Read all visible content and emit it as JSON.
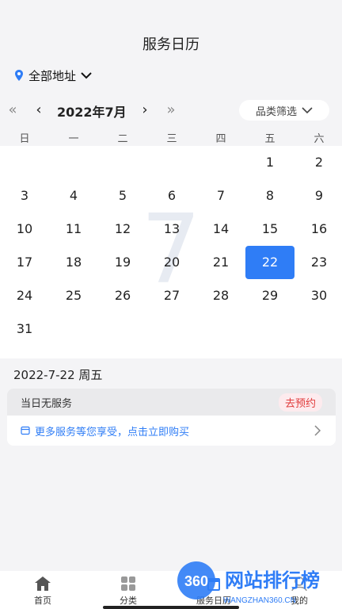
{
  "header": {
    "title": "服务日历"
  },
  "address": {
    "label": "全部地址"
  },
  "calendar_nav": {
    "prev_year": "«",
    "prev_month": "‹",
    "month_label": "2022年7月",
    "next_month": "›",
    "next_year": "»",
    "filter_label": "品类筛选"
  },
  "weekdays": [
    "日",
    "一",
    "二",
    "三",
    "四",
    "五",
    "六"
  ],
  "calendar": {
    "watermark": "7",
    "days": [
      "1",
      "2",
      "3",
      "4",
      "5",
      "6",
      "7",
      "8",
      "9",
      "10",
      "11",
      "12",
      "13",
      "14",
      "15",
      "16",
      "17",
      "18",
      "19",
      "20",
      "21",
      "22",
      "23",
      "24",
      "25",
      "26",
      "27",
      "28",
      "29",
      "30",
      "31"
    ],
    "first_weekday": 5,
    "selected_day": "22"
  },
  "selected": {
    "date_heading": "2022-7-22 周五",
    "no_service": "当日无服务",
    "reserve_label": "去预约",
    "promo_text": "更多服务等您享受，点击立即购买"
  },
  "tabbar": {
    "items": [
      {
        "label": "首页",
        "icon": "home-icon"
      },
      {
        "label": "分类",
        "icon": "category-icon"
      },
      {
        "label": "服务日历",
        "icon": "calendar-icon"
      },
      {
        "label": "我的",
        "icon": "profile-icon"
      }
    ]
  },
  "watermark_logo": {
    "badge": "360",
    "title": "网站排行榜",
    "subtitle": "WANGZHAN360.CN"
  },
  "colors": {
    "accent": "#2f7df6",
    "reserve_text": "#e03a3a",
    "reserve_bg": "#fdebee",
    "background": "#f4f4f6"
  }
}
